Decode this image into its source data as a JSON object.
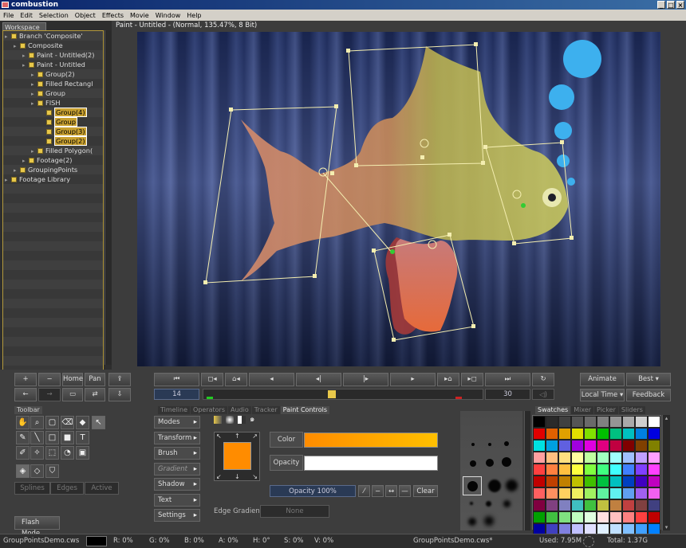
{
  "app": {
    "title": "combustion"
  },
  "menu": [
    "File",
    "Edit",
    "Selection",
    "Object",
    "Effects",
    "Movie",
    "Window",
    "Help"
  ],
  "workspace": {
    "tab": "Workspace",
    "tree": [
      {
        "label": "Branch 'Composite'",
        "indent": 0
      },
      {
        "label": "Composite",
        "indent": 1
      },
      {
        "label": "Paint - Untitled(2)",
        "indent": 2
      },
      {
        "label": "Paint - Untitled",
        "indent": 2
      },
      {
        "label": "Group(2)",
        "indent": 3
      },
      {
        "label": "Filled Rectangl",
        "indent": 3
      },
      {
        "label": "Group",
        "indent": 3
      },
      {
        "label": "FISH",
        "indent": 3
      },
      {
        "label": "Group(4)",
        "indent": 4,
        "selected": true
      },
      {
        "label": "Group",
        "indent": 4,
        "selected": true
      },
      {
        "label": "Group(3)",
        "indent": 4,
        "selected": true
      },
      {
        "label": "Group(2)",
        "indent": 4,
        "selected": true
      },
      {
        "label": "Filled Polygon(",
        "indent": 3
      },
      {
        "label": "Footage(2)",
        "indent": 2
      },
      {
        "label": "GroupingPoints",
        "indent": 1
      },
      {
        "label": "Footage Library",
        "indent": 0
      }
    ]
  },
  "viewer": {
    "title": "Paint - Untitled -  (Normal, 135.47%, 8 Bit)"
  },
  "nav": {
    "plus": "+",
    "minus": "−",
    "home": "Home",
    "pan": "Pan"
  },
  "transport": {
    "frame": "14",
    "end_frame": "30",
    "animate": "Animate",
    "quality": "Best",
    "time_mode": "Local Time",
    "feedback": "Feedback",
    "timeline_progress": 0.46
  },
  "toolbar": {
    "label": "Toolbar",
    "splines": "Splines",
    "edges": "Edges",
    "active": "Active",
    "flash_mode": "Flash Mode"
  },
  "panel_tabs": [
    "Timeline",
    "Operators",
    "Audio",
    "Tracker",
    "Paint Controls"
  ],
  "menu_buttons": [
    "Modes",
    "Transform",
    "Brush",
    "Gradient",
    "Shadow",
    "Text",
    "Settings"
  ],
  "paint": {
    "color_label": "Color",
    "opacity_label": "Opacity",
    "opacity_value": "Opacity 100%",
    "clear": "Clear",
    "edge_gradient": "Edge Gradient",
    "edge_value": "None",
    "swatch": "#ff8c00"
  },
  "swatch_tabs": [
    "Swatches",
    "Mixer",
    "Picker",
    "Sliders"
  ],
  "swatches": [
    "#000000",
    "#2a2a2a",
    "#404040",
    "#555555",
    "#6a6a6a",
    "#808080",
    "#959595",
    "#aaaaaa",
    "#cfcfcf",
    "#ffffff",
    "#e00000",
    "#e06000",
    "#e0a000",
    "#e0e000",
    "#80e000",
    "#00c000",
    "#00c080",
    "#00c0c0",
    "#0080e0",
    "#0000e0",
    "#00e0e0",
    "#00a0e0",
    "#6060e0",
    "#a000e0",
    "#e000e0",
    "#e00080",
    "#c00040",
    "#800000",
    "#804000",
    "#808000",
    "#ffa0a0",
    "#ffc080",
    "#ffe080",
    "#ffffa0",
    "#c0ffa0",
    "#a0ffc0",
    "#a0ffff",
    "#a0c0ff",
    "#c0a0ff",
    "#ffa0ff",
    "#ff4040",
    "#ff8040",
    "#ffc040",
    "#ffff40",
    "#80ff40",
    "#40ff80",
    "#40ffff",
    "#4080ff",
    "#8040ff",
    "#ff40ff",
    "#c00000",
    "#c04000",
    "#c08000",
    "#c0c000",
    "#40c000",
    "#00c040",
    "#00c0c0",
    "#0040c0",
    "#4000c0",
    "#c000c0",
    "#ff6060",
    "#ff9060",
    "#ffd060",
    "#f0f060",
    "#a0f060",
    "#60f0a0",
    "#60f0f0",
    "#60a0f0",
    "#a060f0",
    "#f060f0",
    "#800040",
    "#804080",
    "#8080c0",
    "#40c0c0",
    "#40c040",
    "#c0c040",
    "#c08040",
    "#c04040",
    "#804040",
    "#404080",
    "#00a000",
    "#40c040",
    "#80e080",
    "#c0ffc0",
    "#e0ffe0",
    "#ffe0e0",
    "#ffc0c0",
    "#ff8080",
    "#ff4040",
    "#c00000",
    "#0000a0",
    "#4040c0",
    "#8080e0",
    "#c0c0ff",
    "#e0e0ff",
    "#e0f0ff",
    "#c0e0ff",
    "#80c0ff",
    "#40a0ff",
    "#0080ff"
  ],
  "status": {
    "file": "GroupPointsDemo.cws",
    "r": "R: 0%",
    "g": "G: 0%",
    "b": "B: 0%",
    "a": "A: 0%",
    "h": "H: 0°",
    "s": "S: 0%",
    "v": "V: 0%",
    "file2": "GroupPointsDemo.cws*",
    "used": "Used: 7.95M",
    "total": "Total: 1.37G"
  }
}
